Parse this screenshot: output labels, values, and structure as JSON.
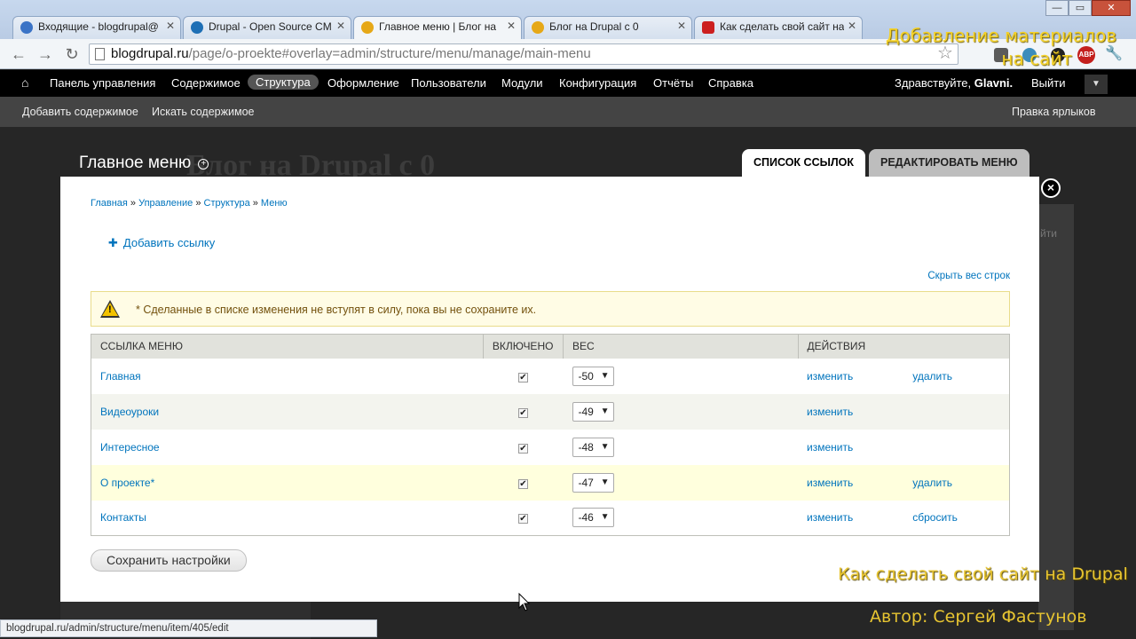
{
  "browser": {
    "tabs": [
      {
        "title": "Входящие - blogdrupal@",
        "favicon_color": "#3a73c6"
      },
      {
        "title": "Drupal - Open Source CM",
        "favicon_color": "#1e6fb5"
      },
      {
        "title": "Главное меню | Блог на",
        "favicon_color": "#e6a817",
        "active": true
      },
      {
        "title": "Блог на Drupal c 0",
        "favicon_color": "#e6a817"
      },
      {
        "title": "Как сделать свой сайт на",
        "favicon_color": "#cc1f1f"
      }
    ],
    "address": {
      "host": "blogdrupal.ru",
      "path": "/page/o-proekte#overlay=admin/structure/menu/manage/main-menu"
    },
    "extensions": [
      "star-icon",
      "puzzle-icon",
      "globe-icon",
      "github-icon",
      "abp-icon",
      "wrench-icon"
    ],
    "abp_label": "ABP"
  },
  "toolbar": {
    "items": [
      "Панель управления",
      "Содержимое",
      "Структура",
      "Оформление",
      "Пользователи",
      "Модули",
      "Конфигурация",
      "Отчёты",
      "Справка"
    ],
    "active_index": 2,
    "greeting_prefix": "Здравствуйте, ",
    "greeting_user": "Glavni.",
    "logout": "Выйти"
  },
  "shortcuts": {
    "items": [
      "Добавить содержимое",
      "Искать содержимое"
    ],
    "edit": "Правка ярлыков"
  },
  "background": {
    "site_title": "Блог на Drupal с 0",
    "side_text": "йти"
  },
  "overlay": {
    "title": "Главное меню",
    "tabs": [
      "СПИСОК ССЫЛОК",
      "РЕДАКТИРОВАТЬ МЕНЮ"
    ],
    "close_label": "×",
    "breadcrumb": [
      "Главная",
      "Управление",
      "Структура",
      "Меню"
    ],
    "breadcrumb_sep": " » ",
    "add_link": "Добавить ссылку",
    "hide_weights": "Скрыть вес строк",
    "warning": "* Сделанные в списке изменения не вступят в силу, пока вы не сохраните их.",
    "table": {
      "headers": [
        "ССЫЛКА МЕНЮ",
        "ВКЛЮЧЕНО",
        "ВЕС",
        "ДЕЙСТВИЯ"
      ],
      "rows": [
        {
          "title": "Главная",
          "enabled": true,
          "weight": "-50",
          "edit": "изменить",
          "op": "удалить"
        },
        {
          "title": "Видеоуроки",
          "enabled": true,
          "weight": "-49",
          "edit": "изменить",
          "op": ""
        },
        {
          "title": "Интересное",
          "enabled": true,
          "weight": "-48",
          "edit": "изменить",
          "op": ""
        },
        {
          "title": "О проекте*",
          "enabled": true,
          "weight": "-47",
          "edit": "изменить",
          "op": "удалить",
          "changed": true
        },
        {
          "title": "Контакты",
          "enabled": true,
          "weight": "-46",
          "edit": "изменить",
          "op": "сбросить"
        }
      ]
    },
    "save": "Сохранить настройки"
  },
  "status_url": "blogdrupal.ru/admin/structure/menu/item/405/edit",
  "watermarks": {
    "top_line1": "Добавление материалов",
    "top_line2": "на сайт",
    "mid": "Как сделать свой сайт на Drupal",
    "author": "Автор: Сергей Фастунов"
  }
}
